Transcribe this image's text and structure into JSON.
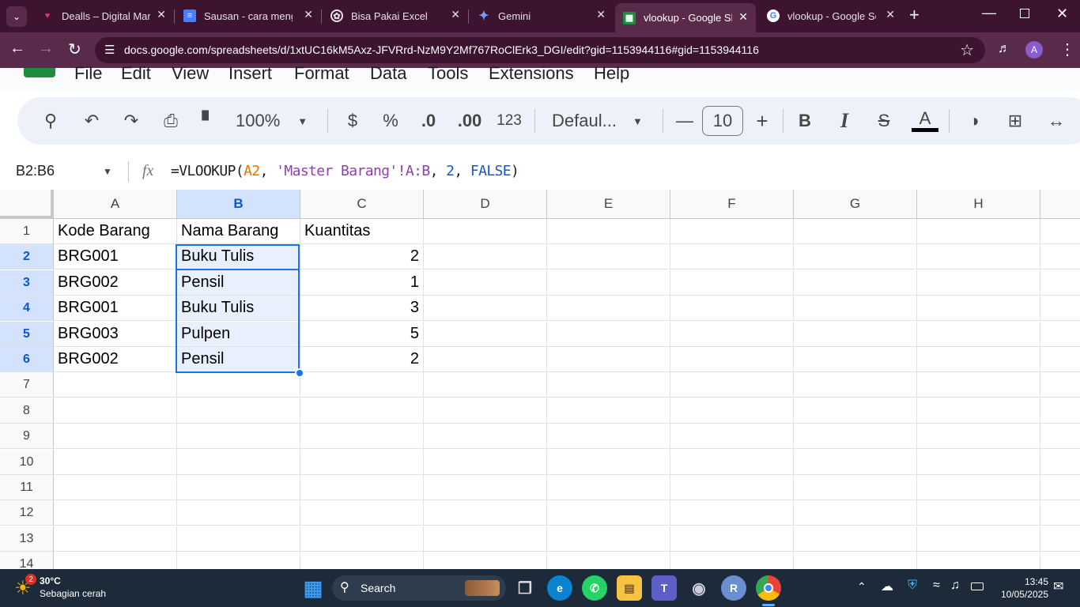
{
  "browser": {
    "tabs": [
      {
        "title": "Dealls – Digital Marke",
        "fav_color": "#e0346a"
      },
      {
        "title": "Sausan - cara menggu",
        "fav_color": "#4a7ff5"
      },
      {
        "title": "Bisa Pakai Excel",
        "fav_color": "#e8dfe5"
      },
      {
        "title": "Gemini",
        "fav_color": "#6ea0ff"
      },
      {
        "title": "vlookup - Google She",
        "fav_color": "#1e8e3e"
      },
      {
        "title": "vlookup - Google Sea",
        "fav_color": "#4285f4"
      }
    ],
    "new_tab": "+",
    "url": "docs.google.com/spreadsheets/d/1xtUC16kM5Axz-JFVRrd-NzM9Y2Mf767RoClErk3_DGI/edit?gid=1153944116#gid=1153944116",
    "profile_initial": "A"
  },
  "menu": [
    "File",
    "Edit",
    "View",
    "Insert",
    "Format",
    "Data",
    "Tools",
    "Extensions",
    "Help"
  ],
  "toolbar": {
    "zoom": "100%",
    "currency": "$",
    "percent": "%",
    "dec_decrease": ".0",
    "dec_increase": ".00",
    "number_format": "123",
    "font": "Defaul...",
    "font_size": "10",
    "bold": "B",
    "italic": "I",
    "text_color": "A"
  },
  "formula_bar": {
    "name_box": "B2:B6",
    "fx": "fx",
    "formula": {
      "prefix": "=VLOOKUP(",
      "ref": "A2",
      "sep1": ", ",
      "range": "'Master Barang'!A:B",
      "sep2": ", ",
      "index": "2",
      "sep3": ", ",
      "bool": "FALSE",
      "suffix": ")"
    }
  },
  "sheet": {
    "columns": [
      "A",
      "B",
      "C",
      "D",
      "E",
      "F",
      "G",
      "H"
    ],
    "rows": [
      "1",
      "2",
      "3",
      "4",
      "5",
      "6",
      "7",
      "8",
      "9",
      "10",
      "11",
      "12",
      "13",
      "14"
    ],
    "cells": [
      [
        "Kode Barang",
        "Nama Barang",
        "Kuantitas"
      ],
      [
        "BRG001",
        "Buku Tulis",
        "2"
      ],
      [
        "BRG002",
        "Pensil",
        "1"
      ],
      [
        "BRG001",
        "Buku Tulis",
        "3"
      ],
      [
        "BRG003",
        "Pulpen",
        "5"
      ],
      [
        "BRG002",
        "Pensil",
        "2"
      ]
    ],
    "selection_color": "#1a73e8"
  },
  "taskbar": {
    "weather_temp": "30°C",
    "weather_desc": "Sebagian cerah",
    "weather_badge": "2",
    "search_label": "Search",
    "time": "13:45",
    "date": "10/05/2025"
  }
}
